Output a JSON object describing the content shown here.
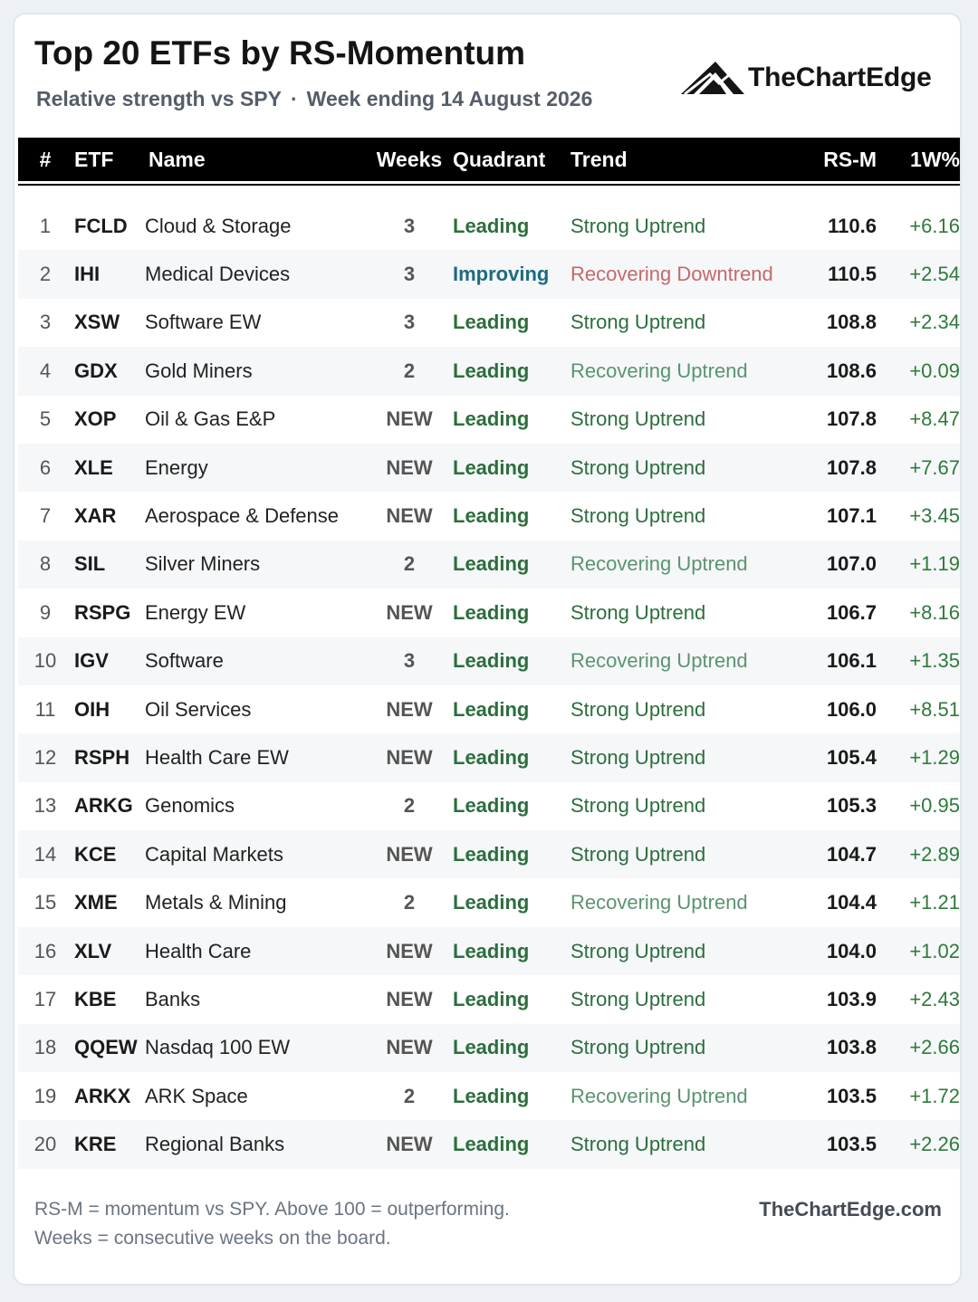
{
  "header": {
    "title": "Top 20 ETFs by RS-Momentum",
    "subtitle_left": "Relative strength vs SPY",
    "subtitle_sep": "·",
    "subtitle_right": "Week ending 14 August 2026",
    "brand": "TheChartEdge"
  },
  "colors": {
    "leading": "#2c6e3d",
    "improving": "#1e6b80",
    "strong_uptrend": "#2c6e3d",
    "recovering_uptrend": "#5a9470",
    "recovering_downtrend": "#c4696a",
    "positive_change": "#2f7a3b"
  },
  "chart_data": {
    "type": "table",
    "columns": [
      "#",
      "ETF",
      "Name",
      "Weeks",
      "Quadrant",
      "Trend",
      "RS-M",
      "1W%"
    ],
    "rows": [
      {
        "rank": "1",
        "etf": "FCLD",
        "name": "Cloud & Storage",
        "weeks": "3",
        "quadrant": "Leading",
        "trend": "Strong Uptrend",
        "rsm": "110.6",
        "chg": "+6.16"
      },
      {
        "rank": "2",
        "etf": "IHI",
        "name": "Medical Devices",
        "weeks": "3",
        "quadrant": "Improving",
        "trend": "Recovering Downtrend",
        "rsm": "110.5",
        "chg": "+2.54"
      },
      {
        "rank": "3",
        "etf": "XSW",
        "name": "Software EW",
        "weeks": "3",
        "quadrant": "Leading",
        "trend": "Strong Uptrend",
        "rsm": "108.8",
        "chg": "+2.34"
      },
      {
        "rank": "4",
        "etf": "GDX",
        "name": "Gold Miners",
        "weeks": "2",
        "quadrant": "Leading",
        "trend": "Recovering Uptrend",
        "rsm": "108.6",
        "chg": "+0.09"
      },
      {
        "rank": "5",
        "etf": "XOP",
        "name": "Oil & Gas E&P",
        "weeks": "NEW",
        "quadrant": "Leading",
        "trend": "Strong Uptrend",
        "rsm": "107.8",
        "chg": "+8.47"
      },
      {
        "rank": "6",
        "etf": "XLE",
        "name": "Energy",
        "weeks": "NEW",
        "quadrant": "Leading",
        "trend": "Strong Uptrend",
        "rsm": "107.8",
        "chg": "+7.67"
      },
      {
        "rank": "7",
        "etf": "XAR",
        "name": "Aerospace & Defense",
        "weeks": "NEW",
        "quadrant": "Leading",
        "trend": "Strong Uptrend",
        "rsm": "107.1",
        "chg": "+3.45"
      },
      {
        "rank": "8",
        "etf": "SIL",
        "name": "Silver Miners",
        "weeks": "2",
        "quadrant": "Leading",
        "trend": "Recovering Uptrend",
        "rsm": "107.0",
        "chg": "+1.19"
      },
      {
        "rank": "9",
        "etf": "RSPG",
        "name": "Energy EW",
        "weeks": "NEW",
        "quadrant": "Leading",
        "trend": "Strong Uptrend",
        "rsm": "106.7",
        "chg": "+8.16"
      },
      {
        "rank": "10",
        "etf": "IGV",
        "name": "Software",
        "weeks": "3",
        "quadrant": "Leading",
        "trend": "Recovering Uptrend",
        "rsm": "106.1",
        "chg": "+1.35"
      },
      {
        "rank": "11",
        "etf": "OIH",
        "name": "Oil Services",
        "weeks": "NEW",
        "quadrant": "Leading",
        "trend": "Strong Uptrend",
        "rsm": "106.0",
        "chg": "+8.51"
      },
      {
        "rank": "12",
        "etf": "RSPH",
        "name": "Health Care EW",
        "weeks": "NEW",
        "quadrant": "Leading",
        "trend": "Strong Uptrend",
        "rsm": "105.4",
        "chg": "+1.29"
      },
      {
        "rank": "13",
        "etf": "ARKG",
        "name": "Genomics",
        "weeks": "2",
        "quadrant": "Leading",
        "trend": "Strong Uptrend",
        "rsm": "105.3",
        "chg": "+0.95"
      },
      {
        "rank": "14",
        "etf": "KCE",
        "name": "Capital Markets",
        "weeks": "NEW",
        "quadrant": "Leading",
        "trend": "Strong Uptrend",
        "rsm": "104.7",
        "chg": "+2.89"
      },
      {
        "rank": "15",
        "etf": "XME",
        "name": "Metals & Mining",
        "weeks": "2",
        "quadrant": "Leading",
        "trend": "Recovering Uptrend",
        "rsm": "104.4",
        "chg": "+1.21"
      },
      {
        "rank": "16",
        "etf": "XLV",
        "name": "Health Care",
        "weeks": "NEW",
        "quadrant": "Leading",
        "trend": "Strong Uptrend",
        "rsm": "104.0",
        "chg": "+1.02"
      },
      {
        "rank": "17",
        "etf": "KBE",
        "name": "Banks",
        "weeks": "NEW",
        "quadrant": "Leading",
        "trend": "Strong Uptrend",
        "rsm": "103.9",
        "chg": "+2.43"
      },
      {
        "rank": "18",
        "etf": "QQEW",
        "name": "Nasdaq 100 EW",
        "weeks": "NEW",
        "quadrant": "Leading",
        "trend": "Strong Uptrend",
        "rsm": "103.8",
        "chg": "+2.66"
      },
      {
        "rank": "19",
        "etf": "ARKX",
        "name": "ARK Space",
        "weeks": "2",
        "quadrant": "Leading",
        "trend": "Recovering Uptrend",
        "rsm": "103.5",
        "chg": "+1.72"
      },
      {
        "rank": "20",
        "etf": "KRE",
        "name": "Regional Banks",
        "weeks": "NEW",
        "quadrant": "Leading",
        "trend": "Strong Uptrend",
        "rsm": "103.5",
        "chg": "+2.26"
      }
    ]
  },
  "footer": {
    "note_line1": "RS-M = momentum vs SPY.  Above 100 = outperforming.",
    "note_line2": "Weeks = consecutive weeks on the board.",
    "url": "TheChartEdge.com"
  }
}
